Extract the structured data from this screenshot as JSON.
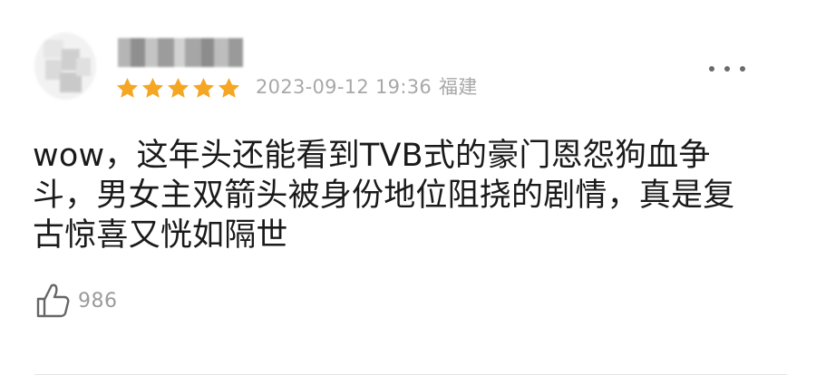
{
  "review": {
    "rating": 5,
    "rating_max": 5,
    "date": "2023-09-12 19:36",
    "location": "福建",
    "comment_lines": [
      "wow，这年头还能看到TVB式的豪门恩怨狗血争",
      "斗，男女主双箭头被身份地位阻挠的剧情，真是复",
      "古惊喜又恍如隔世"
    ],
    "likes": "986"
  },
  "colors": {
    "star": "#f5a623",
    "meta_text": "#a8a8a8",
    "comment_text": "#1a1a1a",
    "like_count": "#9b9b9b"
  },
  "icons": {
    "more": "more-dots-icon",
    "star": "star-icon",
    "like": "thumbs-up-icon"
  }
}
